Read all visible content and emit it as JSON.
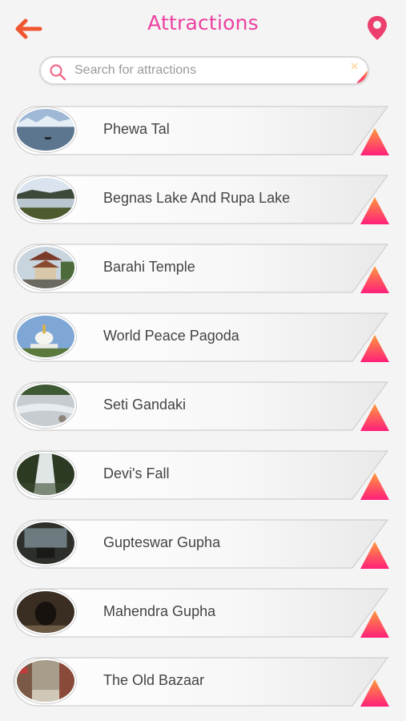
{
  "header": {
    "title": "Attractions",
    "back_icon": "arrow-left-icon",
    "location_icon": "map-pin-icon"
  },
  "search": {
    "placeholder": "Search for attractions",
    "value": ""
  },
  "colors": {
    "accent": "#ec3fa0",
    "back_arrow": "#f0562f",
    "triangle_top": "#ff9a3c",
    "triangle_bottom": "#ff1f7a"
  },
  "attractions": [
    {
      "label": "Phewa Tal",
      "thumb": "lake-photo"
    },
    {
      "label": "Begnas Lake And Rupa Lake",
      "thumb": "lake-photo"
    },
    {
      "label": "Barahi Temple",
      "thumb": "temple-photo"
    },
    {
      "label": "World Peace Pagoda",
      "thumb": "stupa-photo"
    },
    {
      "label": "Seti Gandaki",
      "thumb": "river-photo"
    },
    {
      "label": "Devi's Fall",
      "thumb": "waterfall-photo"
    },
    {
      "label": "Gupteswar Gupha",
      "thumb": "cave-photo"
    },
    {
      "label": "Mahendra Gupha",
      "thumb": "cave-photo"
    },
    {
      "label": "The Old Bazaar",
      "thumb": "bazaar-photo"
    }
  ]
}
